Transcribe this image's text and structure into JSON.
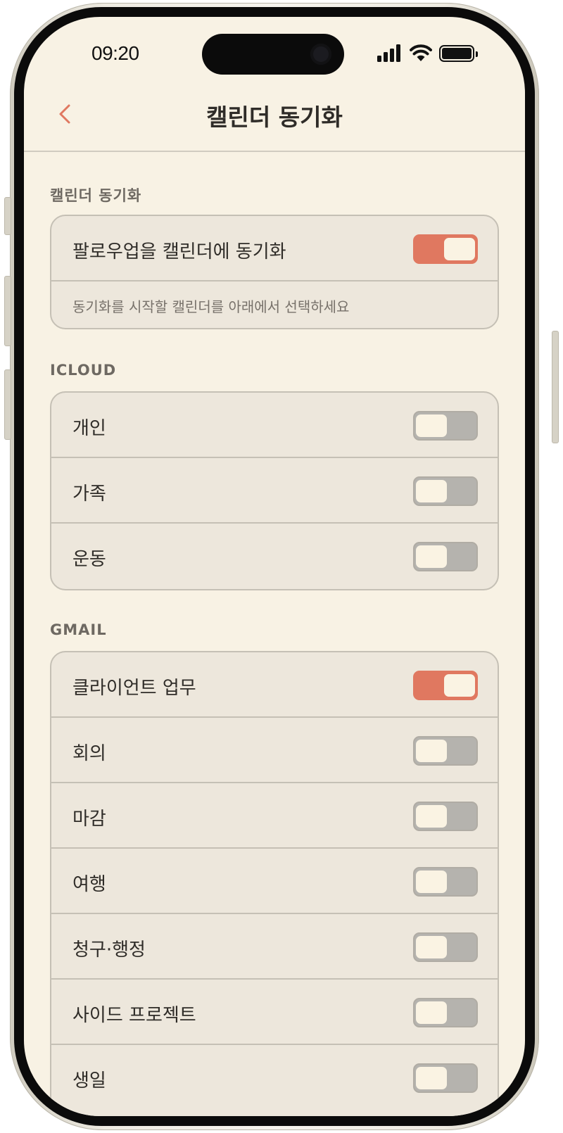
{
  "status_bar": {
    "time": "09:20",
    "icons": [
      "signal-icon",
      "wifi-icon",
      "battery-icon"
    ]
  },
  "nav": {
    "title": "캘린더 동기화",
    "back_icon": "chevron-left-icon"
  },
  "colors": {
    "accent": "#e07860",
    "background": "#f8f2e4",
    "card": "#ede7dc",
    "toggle_off": "#b5b3ae"
  },
  "sync_section": {
    "header": "캘린더 동기화",
    "main_row": {
      "label": "팔로우업을 캘린더에 동기화",
      "on": true
    },
    "hint": "동기화를 시작할 캘린더를 아래에서 선택하세요"
  },
  "icloud": {
    "header": "ICLOUD",
    "rows": [
      {
        "label": "개인",
        "on": false
      },
      {
        "label": "가족",
        "on": false
      },
      {
        "label": "운동",
        "on": false
      }
    ]
  },
  "gmail": {
    "header": "GMAIL",
    "rows": [
      {
        "label": "클라이언트 업무",
        "on": true
      },
      {
        "label": "회의",
        "on": false
      },
      {
        "label": "마감",
        "on": false
      },
      {
        "label": "여행",
        "on": false
      },
      {
        "label": "청구·행정",
        "on": false
      },
      {
        "label": "사이드 프로젝트",
        "on": false
      },
      {
        "label": "생일",
        "on": false
      }
    ]
  }
}
